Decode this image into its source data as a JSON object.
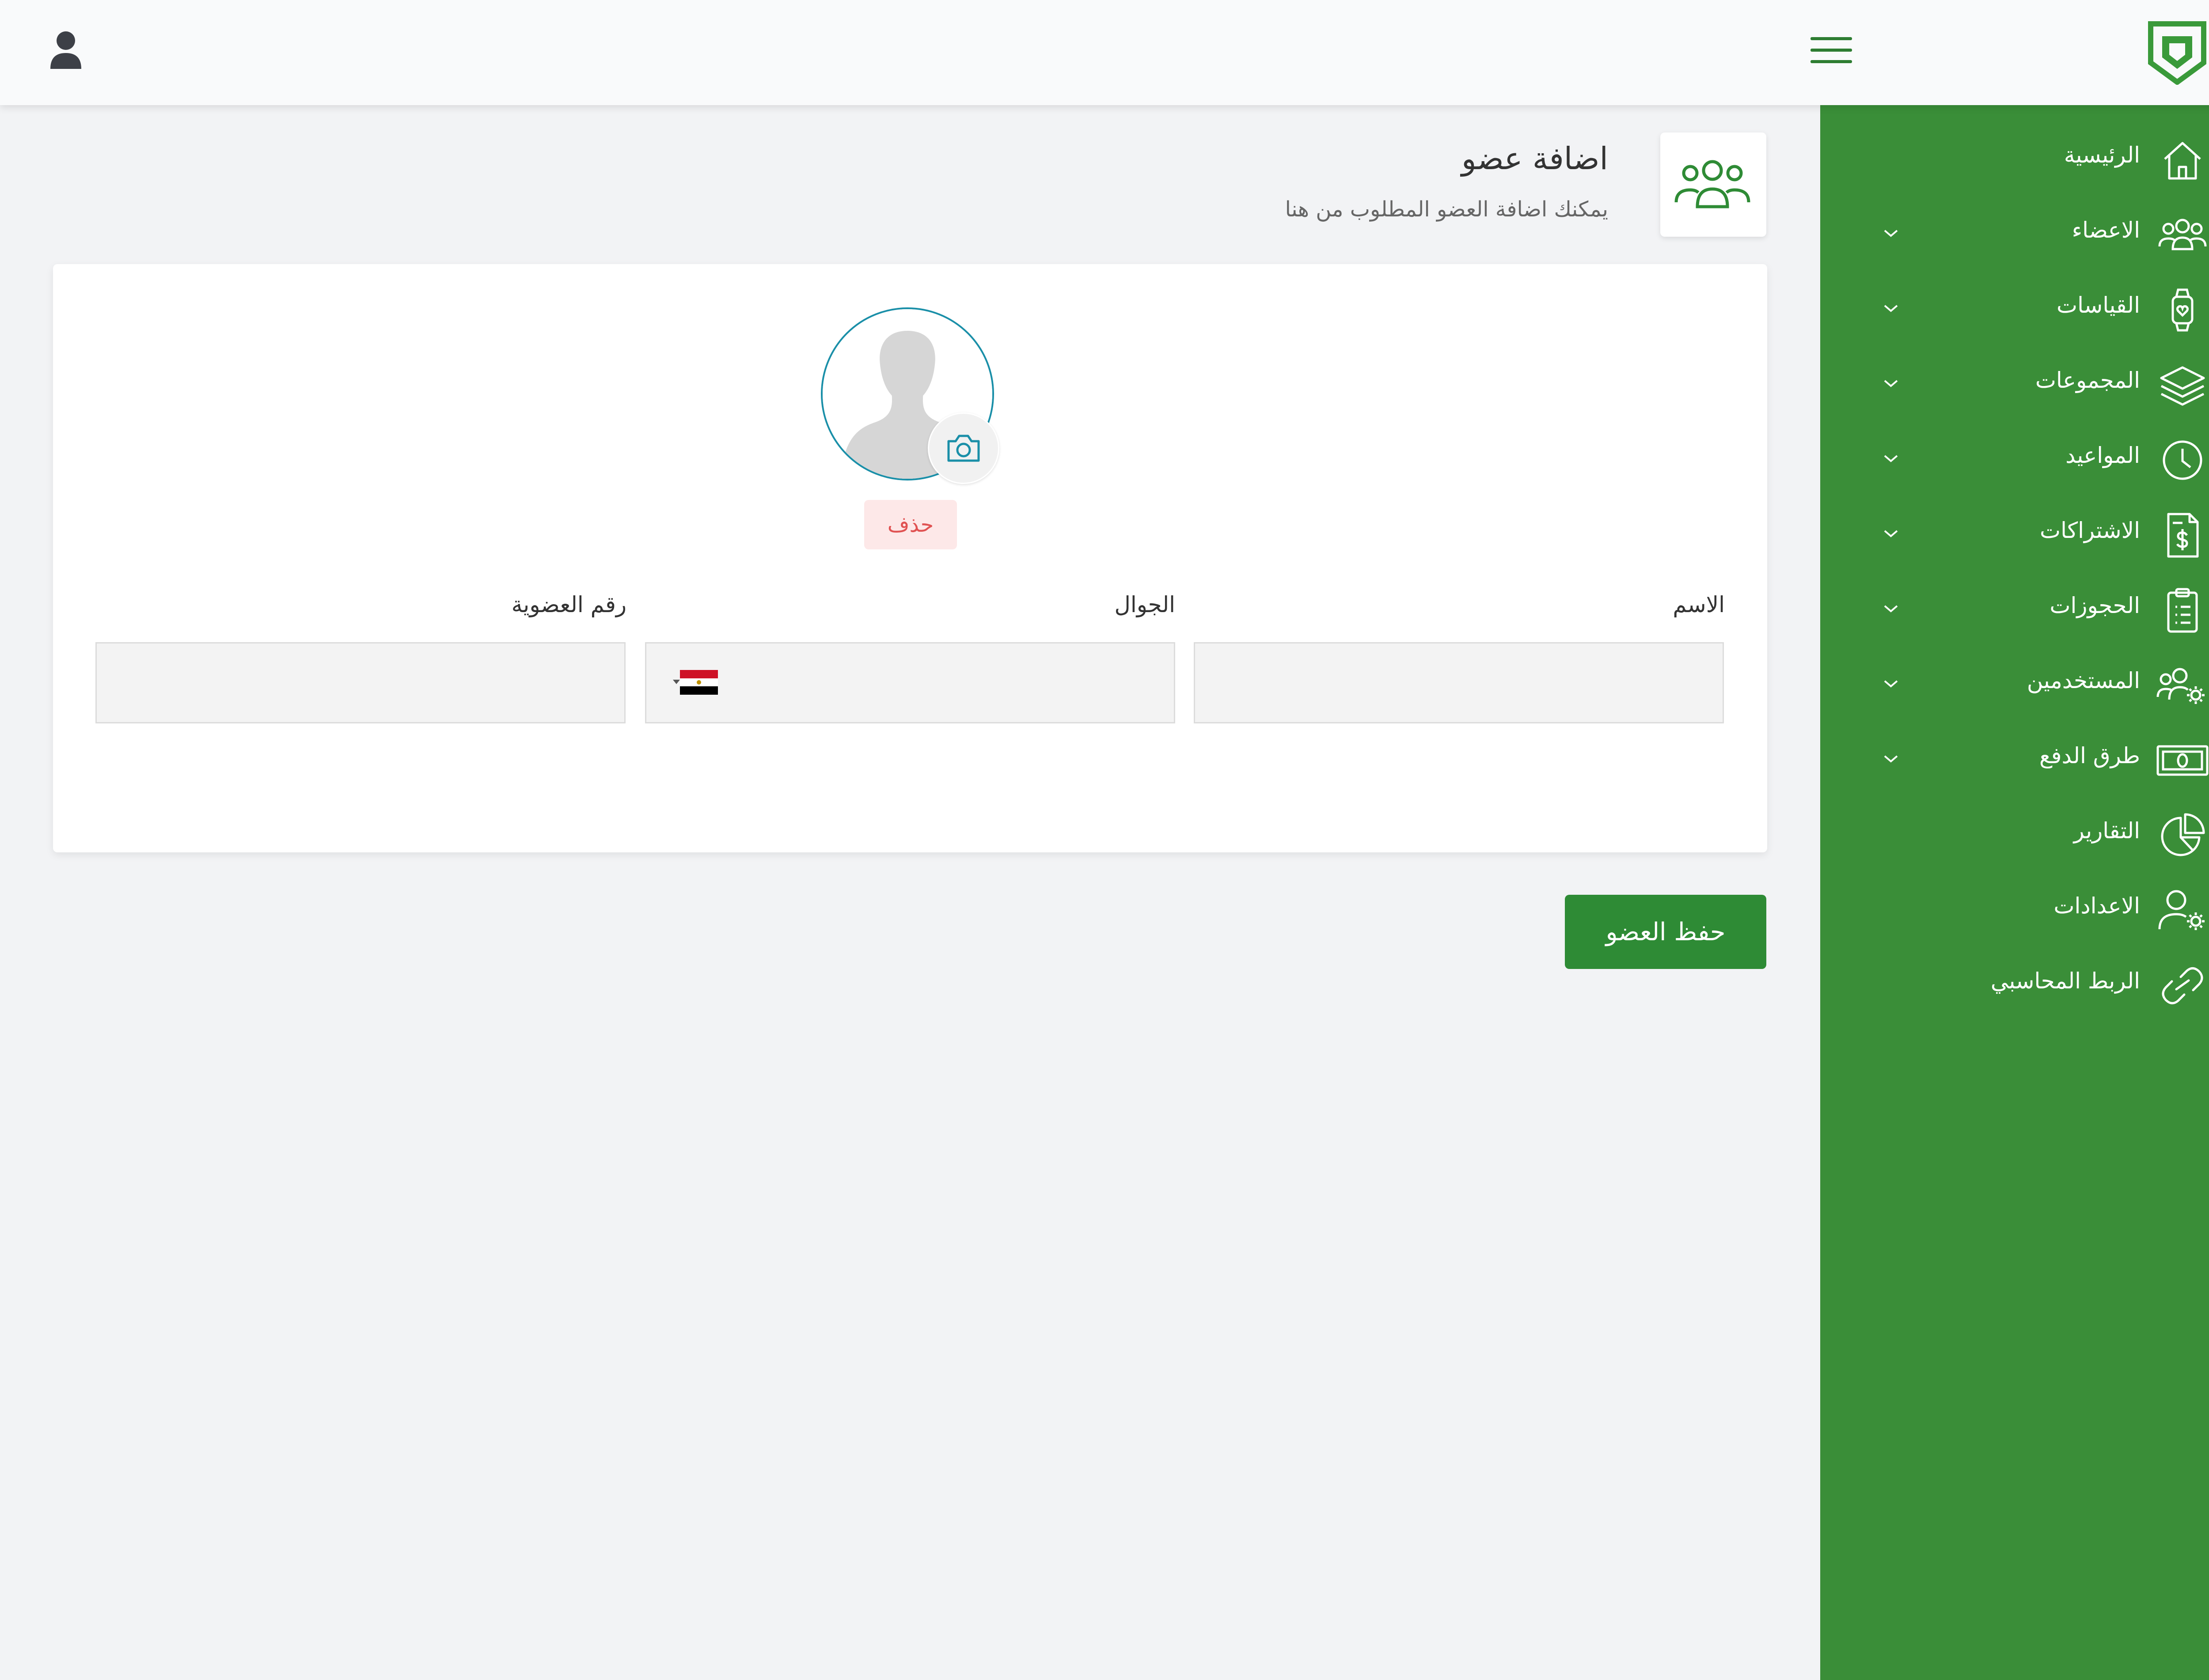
{
  "header": {
    "icons": [
      "user-icon",
      "hamburger-menu-icon",
      "app-logo-icon"
    ]
  },
  "sidebar": {
    "items": [
      {
        "label": "الرئيسية",
        "icon": "home-icon",
        "has_children": false
      },
      {
        "label": "الاعضاء",
        "icon": "users-icon",
        "has_children": true
      },
      {
        "label": "القياسات",
        "icon": "smartwatch-heart-icon",
        "has_children": true
      },
      {
        "label": "المجموعات",
        "icon": "layers-icon",
        "has_children": true
      },
      {
        "label": "المواعيد",
        "icon": "clock-icon",
        "has_children": true
      },
      {
        "label": "الاشتراكات",
        "icon": "invoice-dollar-icon",
        "has_children": true
      },
      {
        "label": "الحجوزات",
        "icon": "clipboard-list-icon",
        "has_children": true
      },
      {
        "label": "المستخدمين",
        "icon": "users-gear-icon",
        "has_children": true
      },
      {
        "label": "طرق الدفع",
        "icon": "banknote-icon",
        "has_children": true
      },
      {
        "label": "التقارير",
        "icon": "pie-chart-icon",
        "has_children": false
      },
      {
        "label": "الاعدادات",
        "icon": "user-gear-icon",
        "has_children": false
      },
      {
        "label": "الربط المحاسبي",
        "icon": "link-icon",
        "has_children": false
      }
    ]
  },
  "page": {
    "title": "اضافة عضو",
    "subtitle": "يمكنك اضافة العضو المطلوب من هنا",
    "icon": "users-icon"
  },
  "form": {
    "avatar_icon": "avatar-placeholder",
    "camera_icon": "camera-icon",
    "delete_label": "حذف",
    "name_label": "الاسم",
    "name_value": "",
    "mobile_label": "الجوال",
    "mobile_value": "",
    "mobile_country_flag": "egypt-flag-icon",
    "membership_label": "رقم العضوية",
    "membership_value": ""
  },
  "actions": {
    "save_label": "حفظ العضو"
  },
  "colors": {
    "sidebar_bg": "#3a8e38",
    "accent": "#2e8b35",
    "avatar_ring": "#1a8fa8",
    "delete_bg": "#fde8e8",
    "delete_text": "#e05252"
  }
}
